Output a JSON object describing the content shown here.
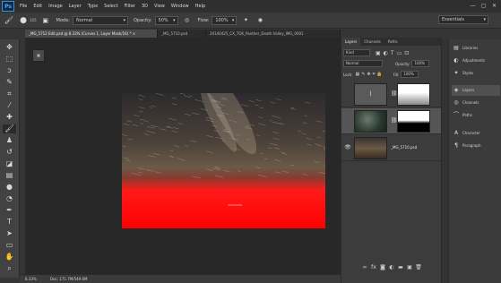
{
  "app": {
    "logo": "Ps"
  },
  "menu": [
    "File",
    "Edit",
    "Image",
    "Layer",
    "Type",
    "Select",
    "Filter",
    "3D",
    "View",
    "Window",
    "Help"
  ],
  "window_controls": [
    "—",
    "▢",
    "✕"
  ],
  "options_bar": {
    "brush_size": "105",
    "mode_label": "Mode:",
    "mode_value": "Normal",
    "opacity_label": "Opacity:",
    "opacity_value": "50%",
    "flow_label": "Flow:",
    "flow_value": "100%",
    "workspace": "Essentials"
  },
  "tabs": [
    {
      "label": "_MG_5712 Edit.psd @ 8.33% (Curves 1, Layer Mask/16) * ×",
      "active": true
    },
    {
      "label": "_MG_5710.psd",
      "active": false
    },
    {
      "label": "20140425_CX_TOX_Panther_Death Valley_IMG_0001",
      "active": false
    }
  ],
  "status": {
    "zoom": "8.33%",
    "doc": "Doc: 171.7M/549.6M"
  },
  "layers_panel": {
    "tabs": [
      "Layers",
      "Channels",
      "Paths"
    ],
    "kind_label": "Kind",
    "blend_mode": "Normal",
    "opacity_label": "Opacity:",
    "opacity_value": "100%",
    "lock_label": "Lock:",
    "fill_label": "Fill:",
    "fill_value": "100%",
    "layers": [
      {
        "name": "",
        "type": "curves-adjustment",
        "visible": false,
        "selected": false
      },
      {
        "name": "",
        "type": "image-with-mask",
        "visible": false,
        "selected": true
      },
      {
        "name": "_MG_5710.psd",
        "type": "image",
        "visible": true,
        "selected": false
      }
    ]
  },
  "collapsed_panels": [
    {
      "label": "Libraries",
      "icon": "libraries-icon"
    },
    {
      "label": "Adjustments",
      "icon": "adjustments-icon"
    },
    {
      "label": "Styles",
      "icon": "styles-icon"
    },
    {
      "label": "Layers",
      "icon": "layers-icon",
      "selected": true
    },
    {
      "label": "Channels",
      "icon": "channels-icon"
    },
    {
      "label": "Paths",
      "icon": "paths-icon"
    },
    {
      "label": "Character",
      "icon": "character-icon"
    },
    {
      "label": "Paragraph",
      "icon": "paragraph-icon"
    }
  ]
}
